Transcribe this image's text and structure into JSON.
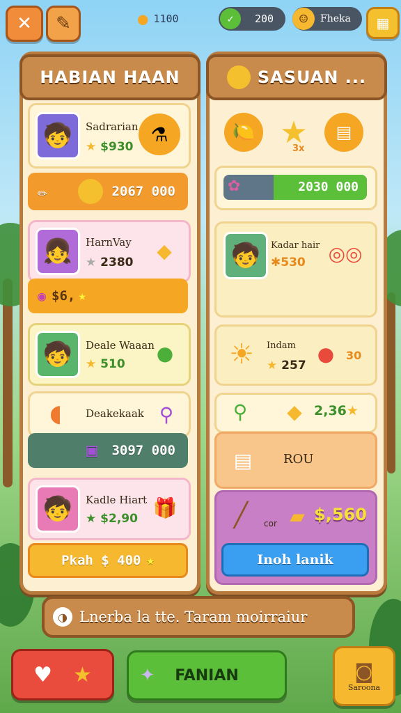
{
  "colors": {
    "wood": "#b97a3e",
    "orange": "#f39a2d",
    "green": "#5bbf3a",
    "blue": "#3a9ff0",
    "red": "#e94b3c"
  },
  "topbar": {
    "close_icon": "close-icon",
    "pencil_icon": "pencil-icon",
    "coins_value": "1100",
    "gems_value": "200",
    "profile_label": "Fheka"
  },
  "left": {
    "title": "HABIAN HAAN",
    "card1": {
      "name": "Sadrarian",
      "price": "$930"
    },
    "bar1": "2067 000",
    "card2": {
      "name": "HarnVay",
      "price": "2380"
    },
    "bar2": "$6,",
    "card3": {
      "name": "Deale Waaan",
      "price": "510"
    },
    "card4": {
      "name": "Deakekaak"
    },
    "bar4": "3097 000",
    "card5": {
      "name": "Kadle Hiart",
      "price": "$2,90"
    },
    "action": "Pkah $ 400"
  },
  "right": {
    "title": "SASUAN ...",
    "star_badge": "3x",
    "bar1": "2030 000",
    "progress_fraction": 0.35,
    "card2": {
      "name": "Kadar hair",
      "price": "530"
    },
    "card3": {
      "name": "Indam",
      "price": "257",
      "extra": "30"
    },
    "card4": {
      "price": "2,36"
    },
    "card5": {
      "label": "ROU"
    },
    "card6": {
      "label": "cor",
      "price": "$,560"
    },
    "action": "Inoh lanik"
  },
  "message": "Lnerba la tte. Taram moirraiur",
  "bottom": {
    "main_label": "FANIAN",
    "side_label": "Saroona"
  }
}
